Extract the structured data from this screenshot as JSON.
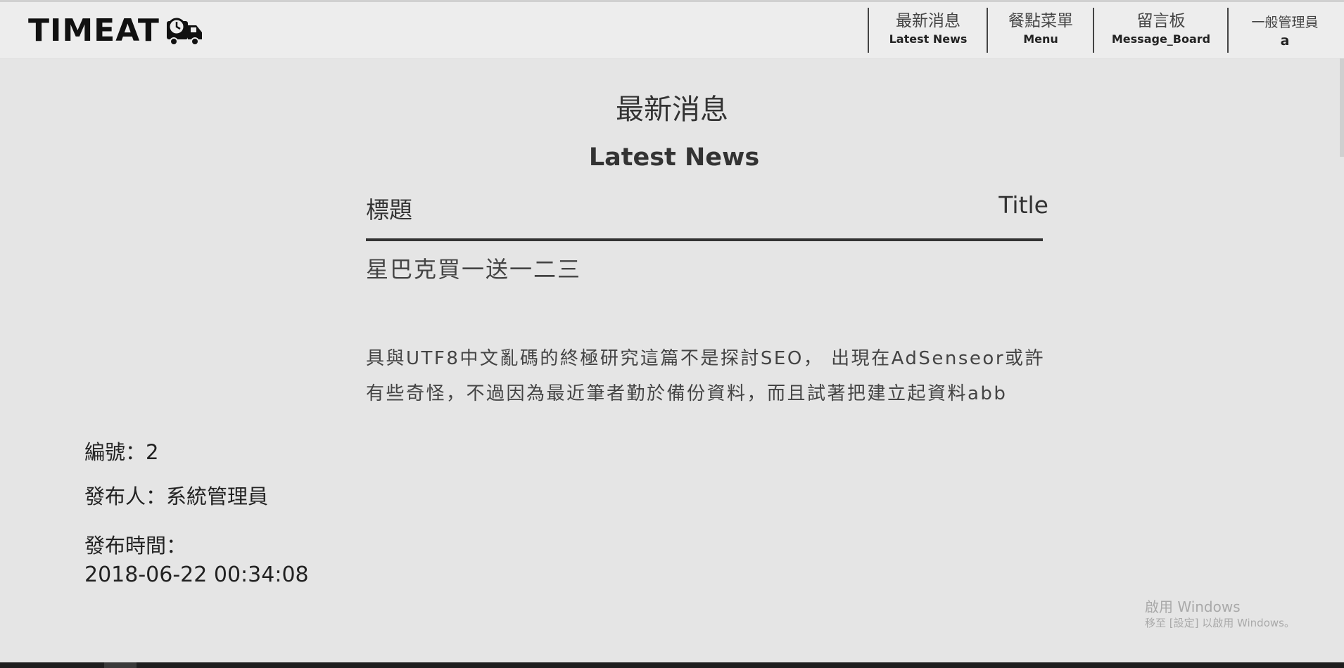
{
  "header": {
    "logo_text": "TIMEAT",
    "logo_icon": "truck-clock-icon",
    "nav": [
      {
        "zh": "最新消息",
        "en": "Latest News"
      },
      {
        "zh": "餐點菜單",
        "en": "Menu"
      },
      {
        "zh": "留言板",
        "en": "Message_Board"
      }
    ],
    "user": {
      "role": "一般管理員",
      "name": "a"
    }
  },
  "main": {
    "title_zh": "最新消息",
    "title_en": "Latest News",
    "column_left": "標題",
    "column_right": "Title",
    "news_title": "星巴克買一送一二三",
    "news_body": "具與UTF8中文亂碼的終極研究這篇不是探討SEO， 出現在AdSenseor或許有些奇怪，不過因為最近筆者勤於備份資料，而且試著把建立起資料abb"
  },
  "meta": {
    "id": "編號：2",
    "author": "發布人：系統管理員",
    "time_label": "發布時間：",
    "time_value": "2018-06-22 00:34:08"
  },
  "watermark": {
    "line1": "啟用 Windows",
    "line2": "移至 [設定] 以啟用 Windows。"
  }
}
